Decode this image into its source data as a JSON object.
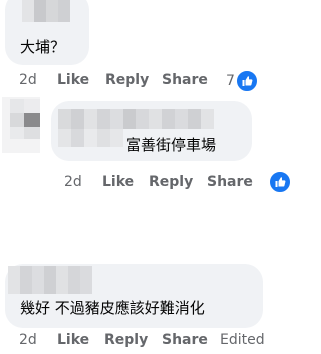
{
  "comments": [
    {
      "text": "大埔？",
      "actions": {
        "time": "2d",
        "like": "Like",
        "reply": "Reply",
        "share": "Share"
      },
      "reaction_count": "7"
    },
    {
      "text": "富善街停車場",
      "actions": {
        "time": "2d",
        "like": "Like",
        "reply": "Reply",
        "share": "Share"
      }
    },
    {
      "text": "幾好 不過豬皮應該好難消化",
      "actions": {
        "time": "2d",
        "like": "Like",
        "reply": "Reply",
        "share": "Share",
        "edited": "Edited"
      }
    }
  ],
  "icons": {
    "reaction": "thumbs-up-icon"
  },
  "colors": {
    "bubble": "#f0f2f5",
    "meta": "#65676b",
    "like_badge": "#1877f2"
  }
}
